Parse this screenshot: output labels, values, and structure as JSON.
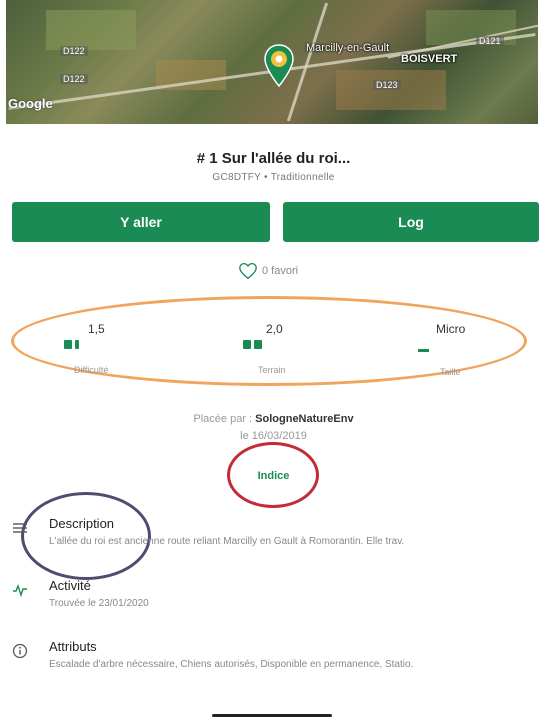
{
  "map": {
    "attribution": "Google",
    "towns": [
      "Marcilly-en-Gault",
      "BOISVERT"
    ],
    "roads": [
      "D121",
      "D122",
      "D123"
    ]
  },
  "cache": {
    "title": "# 1 Sur l'allée du roi...",
    "subtitle": "GC8DTFY • Traditionnelle"
  },
  "actions": {
    "go_label": "Y aller",
    "log_label": "Log"
  },
  "favorites": {
    "label": "0 favori"
  },
  "stats": {
    "difficulty": {
      "value": "1,5",
      "label": "Difficulté",
      "level": 1.5
    },
    "terrain": {
      "value": "2,0",
      "label": "Terrain",
      "level": 2.0
    },
    "size": {
      "value": "Micro",
      "label": "Taille"
    }
  },
  "placed": {
    "prefix": "Placée par :",
    "owner": "SologneNatureEnv",
    "date": "le 16/03/2019"
  },
  "hint_label": "Indice",
  "sections": {
    "description": {
      "title": "Description",
      "text": "L'allée du roi est ancienne route reliant Marcilly en Gault à Romorantin. Elle trav."
    },
    "activity": {
      "title": "Activité",
      "text": "Trouvée le 23/01/2020"
    },
    "attributes": {
      "title": "Attributs",
      "text": "Escalade d'arbre nécessaire, Chiens autorisés, Disponible en permanence, Statio."
    }
  },
  "colors": {
    "accent": "#1a8b52",
    "annotation_orange": "#f0a45c",
    "annotation_red": "#c32b36",
    "annotation_navy": "#4e4c6f"
  }
}
